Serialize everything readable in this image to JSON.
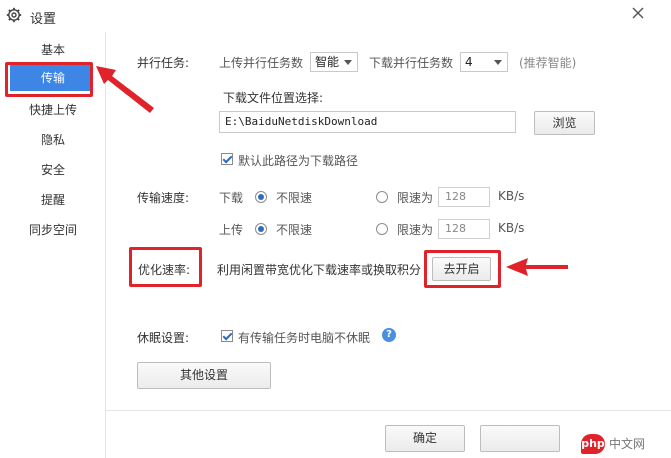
{
  "window": {
    "title": "设置"
  },
  "sidebar": {
    "items": [
      {
        "label": "基本"
      },
      {
        "label": "传输"
      },
      {
        "label": "快捷上传"
      },
      {
        "label": "隐私"
      },
      {
        "label": "安全"
      },
      {
        "label": "提醒"
      },
      {
        "label": "同步空间"
      }
    ],
    "active_index": 1
  },
  "parallel": {
    "label": "并行任务:",
    "upload_label": "上传并行任务数",
    "upload_value": "智能",
    "download_label": "下载并行任务数",
    "download_value": "4",
    "hint": "(推荐智能)"
  },
  "download_location": {
    "label": "下载文件位置选择:",
    "path": "E:\\BaiduNetdiskDownload",
    "browse_label": "浏览",
    "default_checkbox_label": "默认此路径为下载路径",
    "default_checked": true
  },
  "speed": {
    "label": "传输速度:",
    "download_label": "下载",
    "upload_label": "上传",
    "unlimited_label": "不限速",
    "limit_label": "限速为",
    "download_limit_value": "128",
    "upload_limit_value": "128",
    "unit": "KB/s"
  },
  "optimize": {
    "label": "优化速率:",
    "description": "利用闲置带宽优化下载速率或换取积分",
    "button_label": "去开启"
  },
  "sleep": {
    "label": "休眠设置:",
    "checkbox_label": "有传输任务时电脑不休眠",
    "checked": true,
    "help": "?"
  },
  "other_settings_label": "其他设置",
  "footer": {
    "ok_label": "确定"
  },
  "watermark": {
    "logo": "php",
    "text": "中文网"
  },
  "colors": {
    "accent": "#3d86e6",
    "highlight_red": "#e0222a"
  }
}
